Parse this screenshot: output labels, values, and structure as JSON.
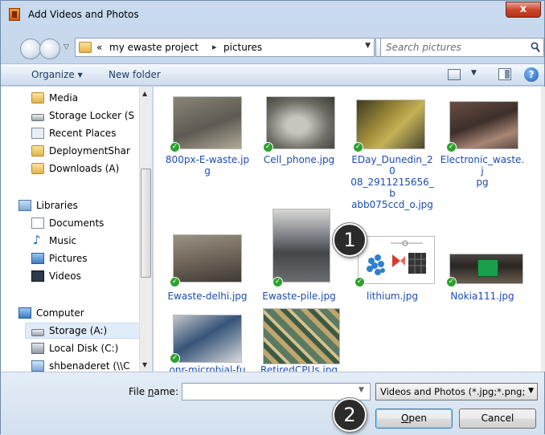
{
  "window": {
    "title": "Add Videos and Photos",
    "close_label": "x"
  },
  "address": {
    "overflow": "«",
    "crumbs": [
      "my ewaste project",
      "pictures"
    ],
    "separator": "▸"
  },
  "search": {
    "placeholder": "Search pictures"
  },
  "toolbar": {
    "organize_label": "Organize ▾",
    "new_folder_label": "New folder",
    "help_label": "?"
  },
  "nav": {
    "items": [
      {
        "label": "Media",
        "icon": "folder-icon"
      },
      {
        "label": "Storage Locker (S",
        "icon": "drive-icon"
      },
      {
        "label": "Recent Places",
        "icon": "recent-places-icon"
      },
      {
        "label": "DeploymentShar",
        "icon": "folder-icon"
      },
      {
        "label": "Downloads (A)",
        "icon": "folder-icon"
      },
      {
        "label": "Libraries",
        "icon": "libraries-icon"
      },
      {
        "label": "Documents",
        "icon": "documents-icon"
      },
      {
        "label": "Music",
        "icon": "music-icon"
      },
      {
        "label": "Pictures",
        "icon": "pictures-icon"
      },
      {
        "label": "Videos",
        "icon": "videos-icon"
      },
      {
        "label": "Computer",
        "icon": "computer-icon"
      },
      {
        "label": "Storage (A:)",
        "icon": "drive-icon"
      },
      {
        "label": "Local Disk (C:)",
        "icon": "local-disk-icon"
      },
      {
        "label": "shbenaderet (\\\\C",
        "icon": "network-drive-icon"
      }
    ]
  },
  "files": [
    {
      "name": "800px-E-waste.jpg",
      "line1": "800px-E-waste.jp",
      "line2": "g",
      "line3": "",
      "colors": [
        "#6c6a60",
        "#a39d8c"
      ]
    },
    {
      "name": "Cell_phone.jpg",
      "line1": "Cell_phone.jpg",
      "line2": "",
      "line3": "",
      "colors": [
        "#4a4a44",
        "#9a9a90"
      ]
    },
    {
      "name": "EDay_Dunedin_2008_2911215656_babb075ccd_o.jpg",
      "line1": "EDay_Dunedin_20",
      "line2": "08_2911215656_b",
      "line3": "abb075ccd_o.jpg",
      "colors": [
        "#5d5a2e",
        "#b49a3c"
      ]
    },
    {
      "name": "Electronic_waste.jpg",
      "line1": "Electronic_waste.j",
      "line2": "pg",
      "line3": "",
      "colors": [
        "#4b3a34",
        "#9c7d6e"
      ]
    },
    {
      "name": "Ewaste-delhi.jpg",
      "line1": "Ewaste-delhi.jpg",
      "line2": "",
      "line3": "",
      "colors": [
        "#7d7365",
        "#5a5248"
      ]
    },
    {
      "name": "Ewaste-pile.jpg",
      "line1": "Ewaste-pile.jpg",
      "line2": "",
      "line3": "",
      "colors": [
        "#595b60",
        "#9ea3a8"
      ]
    },
    {
      "name": "lithium.jpg",
      "line1": "lithium.jpg",
      "line2": "",
      "line3": "",
      "colors": [
        "#ffffff",
        "#3a86c8"
      ]
    },
    {
      "name": "Nokia111.jpg",
      "line1": "Nokia111.jpg",
      "line2": "",
      "line3": "",
      "colors": [
        "#2e2a26",
        "#7a6a5a"
      ]
    },
    {
      "name": "onr-microbial-fu",
      "line1": "onr-microbial-fu",
      "line2": "",
      "line3": "",
      "colors": [
        "#2e4a6c",
        "#c8ccd0"
      ]
    },
    {
      "name": "RetiredCPUs.jpg",
      "line1": "RetiredCPUs.jpg",
      "line2": "",
      "line3": "",
      "colors": [
        "#4f6a56",
        "#c7a86a"
      ]
    }
  ],
  "bottom": {
    "file_name_label_prefix": "File ",
    "file_name_label_accel": "n",
    "file_name_label_suffix": "ame:",
    "file_name_value": "",
    "file_type_selected": "Videos and Photos (*.jpg;*.png;",
    "open_accel": "O",
    "open_rest": "pen",
    "cancel_label": "Cancel"
  },
  "callouts": [
    "1",
    "2"
  ],
  "colors": {
    "accent": "#1a4cb4",
    "check": "#2ea12e",
    "callout": "#2b2b2b"
  }
}
